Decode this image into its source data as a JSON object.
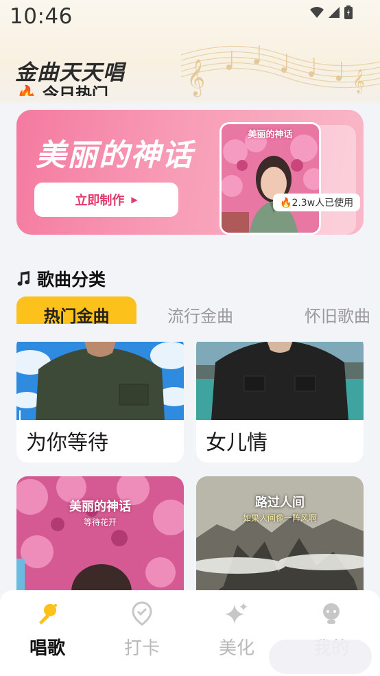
{
  "status_bar": {
    "time": "10:46"
  },
  "header": {
    "app_title": "金曲天天唱",
    "hot_today": "今日热门"
  },
  "banner": {
    "title": "美丽的神话",
    "button_label": "立即制作",
    "poster_title": "美丽的神话",
    "usage": "2.3w人已使用"
  },
  "section": {
    "title": "歌曲分类",
    "tabs": [
      {
        "label": "热门金曲"
      },
      {
        "label": "流行金曲"
      },
      {
        "label": "怀旧歌曲"
      }
    ]
  },
  "songs": [
    {
      "name": "为你等待"
    },
    {
      "name": "女儿情"
    },
    {
      "name": "",
      "poster_title": "美丽的神话",
      "poster_sub": "等待花开"
    },
    {
      "name": "",
      "poster_title": "路过人间",
      "poster_sub": "如果人间像一阵风啊"
    }
  ],
  "bottom_nav": [
    {
      "label": "唱歌",
      "icon": "mic-icon"
    },
    {
      "label": "打卡",
      "icon": "checkin-pin-icon"
    },
    {
      "label": "美化",
      "icon": "sparkle-icon"
    },
    {
      "label": "我的",
      "icon": "profile-icon"
    }
  ],
  "colors": {
    "accent": "#fcc21b",
    "banner_pink": "#f47aa0",
    "cta_text": "#e03b6a"
  }
}
